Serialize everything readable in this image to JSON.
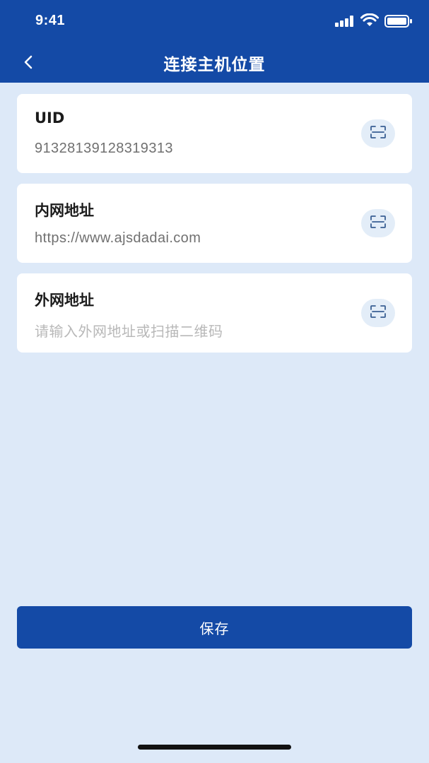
{
  "status_bar": {
    "time": "9:41"
  },
  "nav": {
    "title": "连接主机位置",
    "back_icon": "chevron-left-icon"
  },
  "fields": [
    {
      "label": "UID",
      "value": "91328139128319313",
      "placeholder": "",
      "scan_icon": "scan-icon"
    },
    {
      "label": "内网地址",
      "value": "https://www.ajsdadai.com",
      "placeholder": "",
      "scan_icon": "scan-icon"
    },
    {
      "label": "外网地址",
      "value": "",
      "placeholder": "请输入外网地址或扫描二维码",
      "scan_icon": "scan-icon"
    }
  ],
  "actions": {
    "save_label": "保存"
  },
  "colors": {
    "primary": "#144aa6",
    "background": "#dde9f8",
    "card": "#ffffff",
    "scan_button_bg": "#e3edf8"
  }
}
